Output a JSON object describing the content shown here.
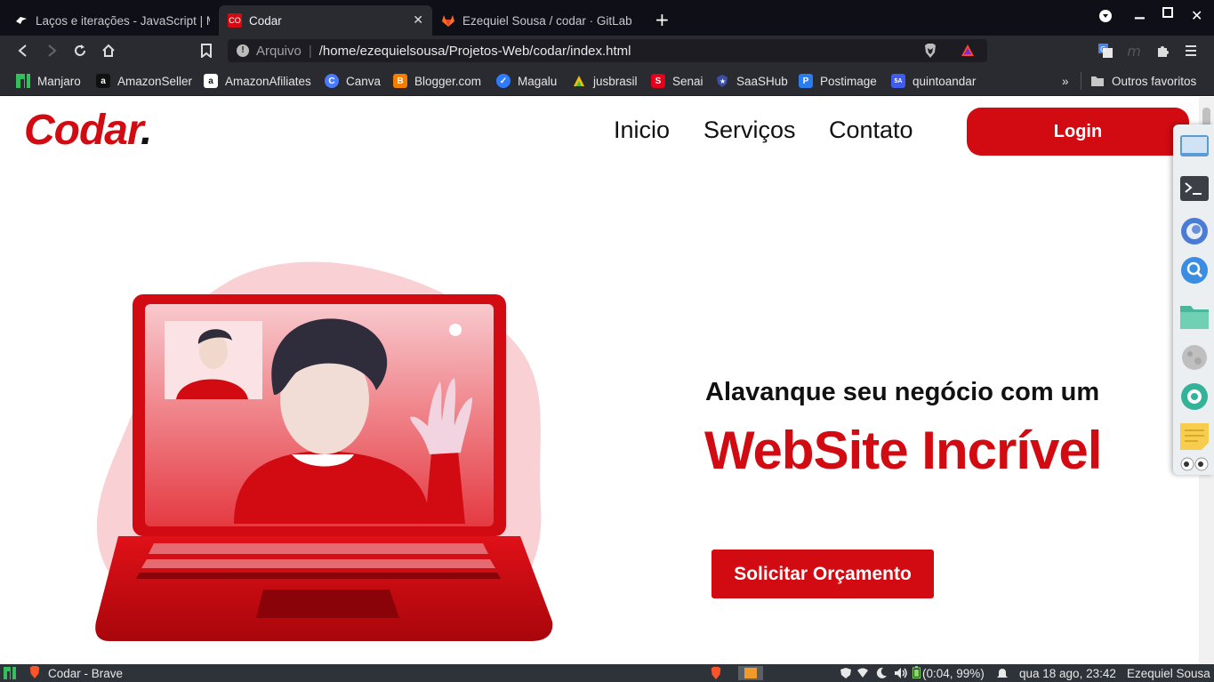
{
  "browser": {
    "tabs": [
      {
        "title": "Laços e iterações - JavaScript | MDN",
        "favicon": "mdn"
      },
      {
        "title": "Codar",
        "favicon": "CO",
        "active": true
      },
      {
        "title": "Ezequiel Sousa / codar · GitLab",
        "favicon": "gitlab"
      }
    ],
    "new_tab": "+",
    "url": {
      "security_label": "Arquivo",
      "path": "/home/ezequielsousa/Projetos-Web/codar/index.html"
    },
    "bookmarks": [
      {
        "label": "Manjaro",
        "color": "#35bf5c"
      },
      {
        "label": "AmazonSeller",
        "color": "#111111"
      },
      {
        "label": "AmazonAfiliates",
        "color": "#ffffff"
      },
      {
        "label": "Canva",
        "color": "#4a7bff"
      },
      {
        "label": "Blogger.com",
        "color": "#f57d00"
      },
      {
        "label": "Magalu",
        "color": "#2f7bff"
      },
      {
        "label": "jusbrasil",
        "color": "#f2c200"
      },
      {
        "label": "Senai",
        "color": "#e2001a"
      },
      {
        "label": "SaaSHub",
        "color": "#3a4fa8"
      },
      {
        "label": "Postimage",
        "color": "#2a7cf0"
      },
      {
        "label": "quintoandar",
        "color": "#3f5cf0"
      }
    ],
    "more_bookmarks": "»",
    "other_favorites": "Outros favoritos"
  },
  "site": {
    "logo": "Codar",
    "logo_dot": ".",
    "nav": [
      "Inicio",
      "Serviços",
      "Contato"
    ],
    "login": "Login",
    "hero_subtitle": "Alavanque seu negócio com um",
    "hero_title": "WebSite Incrível",
    "cta": "Solicitar Orçamento",
    "accent": "#d20a11"
  },
  "taskbar": {
    "window_title": "Codar - Brave",
    "battery": "(0:04, 99%)",
    "clock": "qua 18 ago, 23:42",
    "user": "Ezequiel Sousa"
  }
}
